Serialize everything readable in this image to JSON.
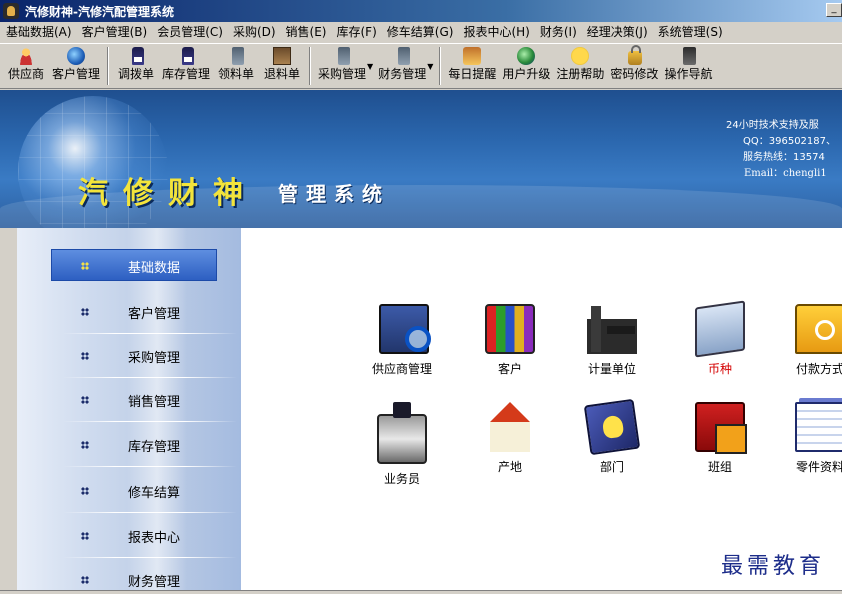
{
  "window": {
    "title": "汽修财神-汽修汽配管理系统",
    "min_glyph": "_"
  },
  "menu": [
    "基础数据(A)",
    "客户管理(B)",
    "会员管理(C)",
    "采购(D)",
    "销售(E)",
    "库存(F)",
    "修车结算(G)",
    "报表中心(H)",
    "财务(I)",
    "经理决策(J)",
    "系统管理(S)"
  ],
  "toolbar": [
    {
      "label": "供应商",
      "icon": "supplier-person-icon"
    },
    {
      "label": "客户管理",
      "icon": "customer-globe-icon"
    },
    {
      "label": "调拨单",
      "icon": "transfer-doc-icon"
    },
    {
      "label": "库存管理",
      "icon": "inventory-doc-icon"
    },
    {
      "label": "领料单",
      "icon": "requisition-icon"
    },
    {
      "label": "退料单",
      "icon": "return-material-icon"
    },
    {
      "label": "采购管理",
      "icon": "purchase-icon"
    },
    {
      "label": "财务管理",
      "icon": "finance-icon"
    },
    {
      "label": "每日提醒",
      "icon": "gift-reminder-icon"
    },
    {
      "label": "用户升级",
      "icon": "upgrade-globe-icon"
    },
    {
      "label": "注册帮助",
      "icon": "help-face-icon"
    },
    {
      "label": "密码修改",
      "icon": "lock-icon"
    },
    {
      "label": "操作导航",
      "icon": "guide-icon"
    }
  ],
  "banner": {
    "brand": "汽修财神",
    "brand_sub": "管理系统",
    "contact": {
      "line1": "24小时技术支持及服",
      "line2": "QQ：396502187、",
      "line3": "服务热线：13574",
      "line4": "Email：chengli1"
    }
  },
  "sidebar": {
    "items": [
      {
        "label": "基础数据",
        "active": true
      },
      {
        "label": "客户管理",
        "active": false
      },
      {
        "label": "采购管理",
        "active": false
      },
      {
        "label": "销售管理",
        "active": false
      },
      {
        "label": "库存管理",
        "active": false
      },
      {
        "label": "修车结算",
        "active": false
      },
      {
        "label": "报表中心",
        "active": false
      },
      {
        "label": "财务管理",
        "active": false
      }
    ]
  },
  "tiles": [
    {
      "label": "供应商管理",
      "icon": "supplier-search-icon",
      "highlight": false
    },
    {
      "label": "客户",
      "icon": "customer-books-icon",
      "highlight": false
    },
    {
      "label": "计量单位",
      "icon": "measurement-unit-icon",
      "highlight": false
    },
    {
      "label": "币种",
      "icon": "currency-computers-icon",
      "highlight": true
    },
    {
      "label": "付款方式",
      "icon": "payment-folder-key-icon",
      "highlight": false
    },
    {
      "label": "业务员",
      "icon": "salesperson-fax-icon",
      "highlight": false
    },
    {
      "label": "产地",
      "icon": "origin-house-icon",
      "highlight": false
    },
    {
      "label": "部门",
      "icon": "department-book-icon",
      "highlight": false
    },
    {
      "label": "班组",
      "icon": "team-folder-icon",
      "highlight": false
    },
    {
      "label": "零件资料",
      "icon": "parts-docs-icon",
      "highlight": false
    }
  ],
  "watermark": "最需教育",
  "colors": {
    "title_bar": "#0a246a",
    "active_menu": "#2d5fc2",
    "brand_yellow": "#f3e43b",
    "highlight_red": "#d40000"
  }
}
